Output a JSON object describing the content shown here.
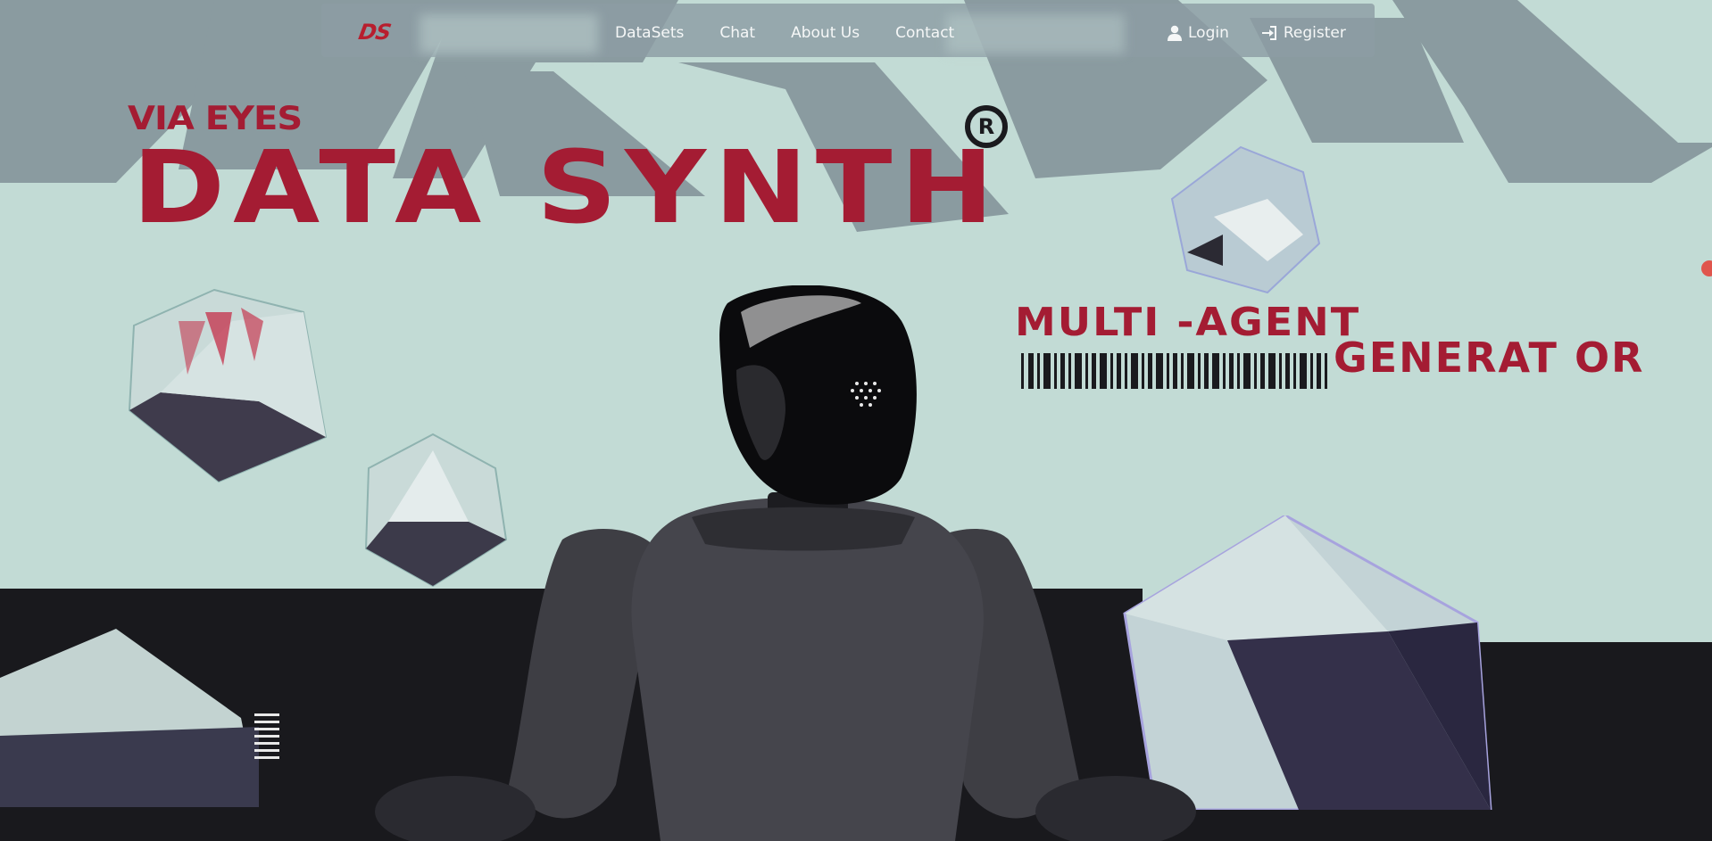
{
  "brand": {
    "logo_text": "DS"
  },
  "nav": {
    "links": [
      {
        "label": "DataSets"
      },
      {
        "label": "Chat"
      },
      {
        "label": "About Us"
      },
      {
        "label": "Contact"
      }
    ],
    "login_label": "Login",
    "register_label": "Register"
  },
  "hero": {
    "eyebrow": "VIA EYES",
    "title": "DATA SYNTH",
    "registered_mark": "R",
    "tagline_line1": "MULTI -AGENT",
    "tagline_line2": "GENERAT OR"
  },
  "colors": {
    "accent_red": "#a41c33",
    "background_mint": "#c2dbd5",
    "navbar": "#8c9ca4",
    "floor": "#19191d"
  }
}
